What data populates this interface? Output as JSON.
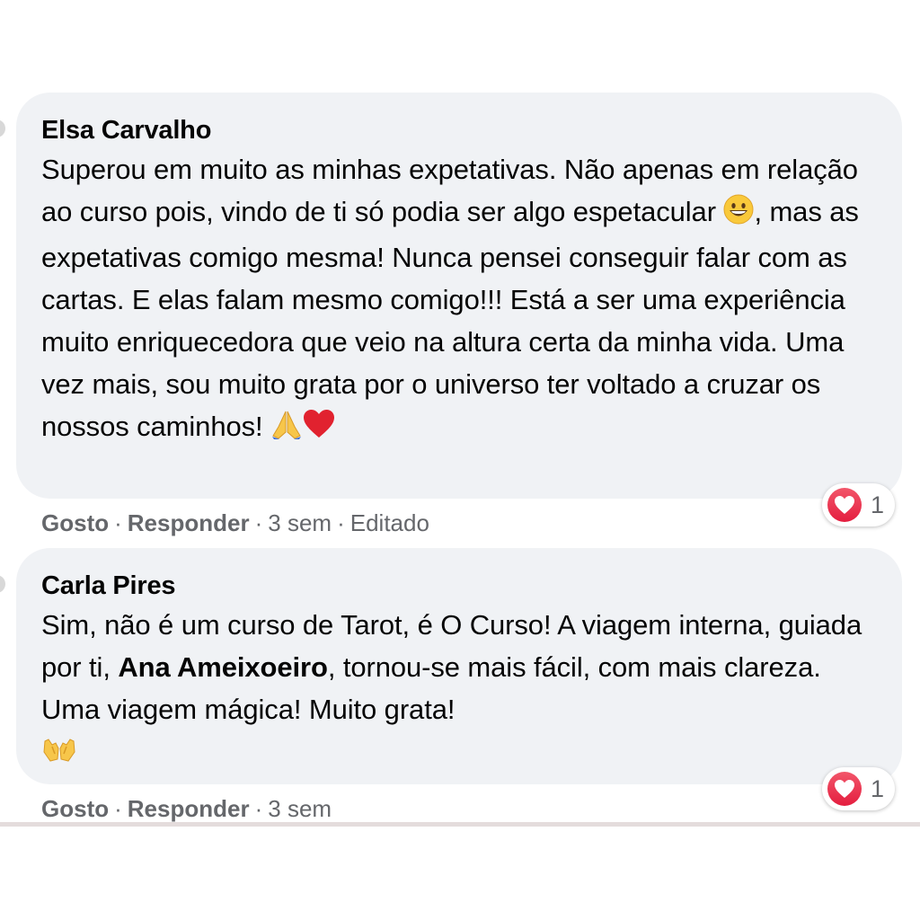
{
  "comments": [
    {
      "author": "Elsa Carvalho",
      "text_before_emoji": "Superou em muito as minhas expetativas. Não apenas em relação ao curso pois, vindo de ti só podia ser algo espetacular ",
      "emoji_inline": "grinning-face",
      "text_after_emoji": ", mas as expetativas comigo mesma! Nunca pensei conseguir falar com as cartas. E elas falam mesmo comigo!!! Está a ser uma experiência muito enriquecedora que veio na altura certa da minha vida. Uma vez mais, sou muito grata por o universo ter voltado a cruzar os nossos caminhos! ",
      "trailing_emojis": [
        "folded-hands",
        "red-heart"
      ],
      "like_label": "Gosto",
      "reply_label": "Responder",
      "time": "3 sem",
      "edited_label": "Editado",
      "reaction_icon": "heart-reaction",
      "reaction_count": "1"
    },
    {
      "author": "Carla Pires",
      "text_before_mention": "Sim, não é um curso de Tarot, é O Curso! A viagem interna, guiada por ti, ",
      "mention": "Ana Ameixoeiro",
      "text_after_mention": ", tornou-se mais fácil, com mais clareza. Uma viagem mágica! Muito grata!",
      "trailing_emojis": [
        "raising-hands"
      ],
      "like_label": "Gosto",
      "reply_label": "Responder",
      "time": "3 sem",
      "reaction_icon": "heart-reaction",
      "reaction_count": "1"
    }
  ],
  "separator": "·",
  "colors": {
    "bubble": "#f0f2f5",
    "text": "#050505",
    "meta": "#65676b",
    "heart": "#e41e3f"
  }
}
